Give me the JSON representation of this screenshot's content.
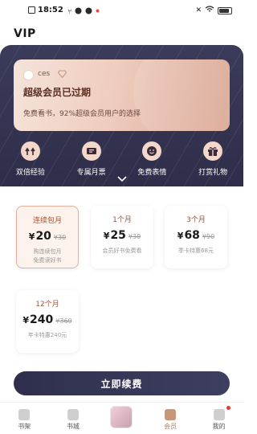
{
  "status_bar": {
    "time": "18:52"
  },
  "header": {
    "title": "VIP"
  },
  "vip_card": {
    "username": "ces",
    "status": "超级会员已过期",
    "description": "免费看书，92%超级会员用户的选择"
  },
  "benefits": [
    {
      "label": "双倍经验",
      "icon": "double-exp-icon"
    },
    {
      "label": "专属月票",
      "icon": "ticket-icon"
    },
    {
      "label": "免费表情",
      "icon": "emoji-icon"
    },
    {
      "label": "打赏礼物",
      "icon": "gift-icon"
    }
  ],
  "plans": [
    {
      "name": "连续包月",
      "currency": "¥",
      "price": "20",
      "original": "¥30",
      "desc1": "购连续包月",
      "desc2": "免费读好书",
      "selected": true
    },
    {
      "name": "1个月",
      "currency": "¥",
      "price": "25",
      "original": "¥30",
      "desc1": "会员好书免费看",
      "desc2": ""
    },
    {
      "name": "3个月",
      "currency": "¥",
      "price": "68",
      "original": "¥90",
      "desc1": "季卡特惠68元",
      "desc2": ""
    },
    {
      "name": "12个月",
      "currency": "¥",
      "price": "240",
      "original": "¥360",
      "desc1": "年卡特惠240元",
      "desc2": ""
    }
  ],
  "renew_button": "立即续费",
  "tabbar": [
    {
      "label": "书架",
      "icon": "bookshelf-icon"
    },
    {
      "label": "书城",
      "icon": "bookstore-icon"
    },
    {
      "label": "",
      "icon": "promo-image"
    },
    {
      "label": "会员",
      "icon": "crown-icon",
      "active": true
    },
    {
      "label": "我的",
      "icon": "profile-icon"
    }
  ],
  "colors": {
    "accent": "#b07b5f",
    "dark_band": "#33334f",
    "card_gold": "#efcdbf",
    "button": "#33334f"
  }
}
